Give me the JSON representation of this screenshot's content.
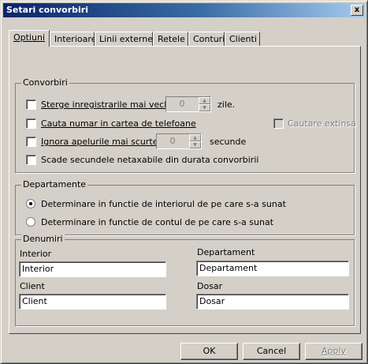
{
  "window": {
    "title": "Setari convorbiri",
    "close_label": "x"
  },
  "tabs": [
    "Optiuni",
    "Interioare",
    "Linii externe",
    "Retele",
    "Conturi",
    "Clienti"
  ],
  "convorbiri": {
    "label": "Convorbiri",
    "sterge": {
      "before": "Sterge inregistrarile mai vechi de",
      "value": "0",
      "after": "zile."
    },
    "cauta": {
      "label": "Cauta numar in cartea de telefoane",
      "extinsa": "Cautare extinsa"
    },
    "ignora": {
      "before": "Ignora apelurile mai scurte de",
      "value": "0",
      "after": "secunde"
    },
    "scade": {
      "label": "Scade secundele netaxabile din durata convorbirii"
    }
  },
  "departamente": {
    "label": "Departamente",
    "opt1": "Determinare in functie de interiorul de pe care s-a sunat",
    "opt2": "Determinare in functie de contul de pe care s-a sunat",
    "selected": 0
  },
  "denumiri": {
    "label": "Denumiri",
    "interior": {
      "label": "Interior",
      "value": "Interior"
    },
    "departament": {
      "label": "Departament",
      "value": "Departament"
    },
    "client": {
      "label": "Client",
      "value": "Client"
    },
    "dosar": {
      "label": "Dosar",
      "value": "Dosar"
    }
  },
  "buttons": {
    "ok": "OK",
    "cancel": "Cancel",
    "apply": "Apply"
  }
}
